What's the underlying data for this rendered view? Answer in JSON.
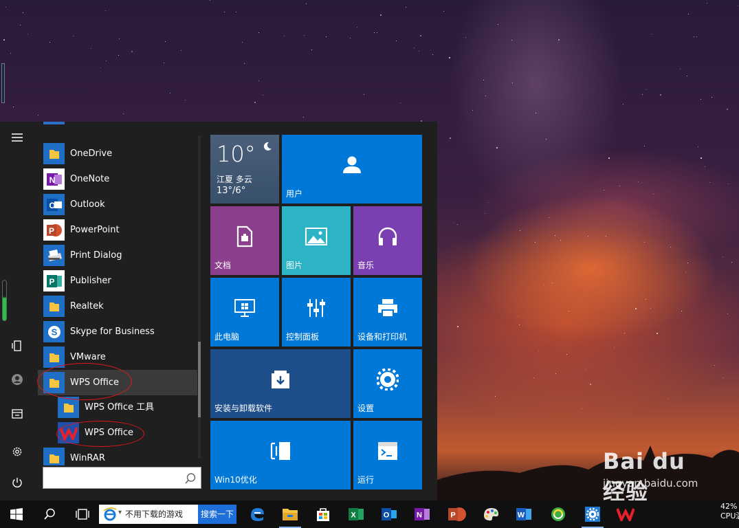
{
  "start_menu": {
    "apps": [
      {
        "label": "OneDrive",
        "icon": "onedrive-folder-icon"
      },
      {
        "label": "OneNote",
        "icon": "onenote-icon"
      },
      {
        "label": "Outlook",
        "icon": "outlook-icon"
      },
      {
        "label": "PowerPoint",
        "icon": "powerpoint-icon"
      },
      {
        "label": "Print Dialog",
        "icon": "printer-icon"
      },
      {
        "label": "Publisher",
        "icon": "publisher-icon"
      },
      {
        "label": "Realtek",
        "icon": "folder-icon"
      },
      {
        "label": "Skype for Business",
        "icon": "skype-icon"
      },
      {
        "label": "VMware",
        "icon": "folder-icon"
      },
      {
        "label": "WPS Office",
        "icon": "folder-icon"
      },
      {
        "label": "WPS Office 工具",
        "icon": "folder-icon"
      },
      {
        "label": "WPS Office",
        "icon": "wps-icon"
      },
      {
        "label": "WinRAR",
        "icon": "folder-icon"
      }
    ],
    "search_placeholder": "",
    "tiles": {
      "weather": {
        "temp": "10°",
        "city": "江夏 多云",
        "range": "13°/6°"
      },
      "user": "用户",
      "documents": "文档",
      "pictures": "图片",
      "music": "音乐",
      "this_pc": "此电脑",
      "control_panel": "控制面板",
      "devices_printers": "设备和打印机",
      "install_uninstall": "安装与卸载软件",
      "settings": "设置",
      "win10_optimize": "Win10优化",
      "run": "运行"
    }
  },
  "taskbar": {
    "ie_search_text": "不用下载的游戏",
    "ie_search_button": "搜索一下",
    "tray_percent": "42%",
    "tray_cpu": "CPU温度"
  },
  "watermark": {
    "logo": "Bai du 经验",
    "url": "jingyan.baidu.com"
  },
  "colors": {
    "tile_blue": "#0078d7",
    "tile_purple": "#8c3f8c",
    "tile_teal": "#2db3c6",
    "tile_violet": "#7a3fb0",
    "tile_dark_blue": "#1e4f8a",
    "annotation_red": "#e0161c"
  }
}
